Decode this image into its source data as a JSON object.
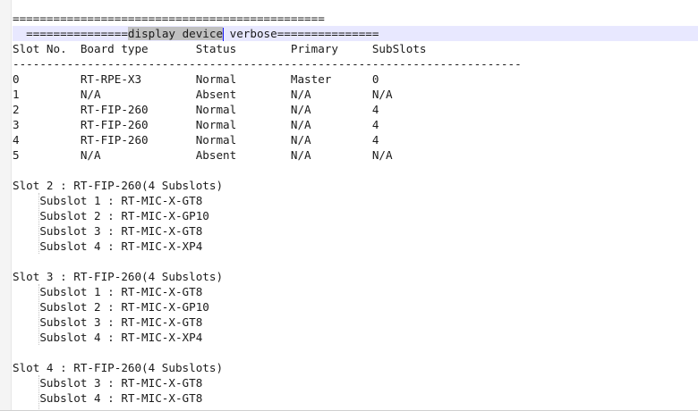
{
  "lines": [
    "==============================================",
    "",
    "Slot No.  Board type       Status        Primary     SubSlots",
    "---------------------------------------------------------------------------",
    "0         RT-RPE-X3        Normal        Master      0",
    "1         N/A              Absent        N/A         N/A",
    "2         RT-FIP-260       Normal        N/A         4",
    "3         RT-FIP-260       Normal        N/A         4",
    "4         RT-FIP-260       Normal        N/A         4",
    "5         N/A              Absent        N/A         N/A",
    "",
    "Slot 2 : RT-FIP-260(4 Subslots)",
    "    Subslot 1 : RT-MIC-X-GT8",
    "    Subslot 2 : RT-MIC-X-GP10",
    "    Subslot 3 : RT-MIC-X-GT8",
    "    Subslot 4 : RT-MIC-X-XP4",
    "",
    "Slot 3 : RT-FIP-260(4 Subslots)",
    "    Subslot 1 : RT-MIC-X-GT8",
    "    Subslot 2 : RT-MIC-X-GP10",
    "    Subslot 3 : RT-MIC-X-GT8",
    "    Subslot 4 : RT-MIC-X-XP4",
    "",
    "Slot 4 : RT-FIP-260(4 Subslots)",
    "    Subslot 3 : RT-MIC-X-GT8",
    "    Subslot 4 : RT-MIC-X-GT8"
  ],
  "current_line": {
    "before": "  ===============",
    "selected": "display device",
    "after": " verbose==============="
  }
}
